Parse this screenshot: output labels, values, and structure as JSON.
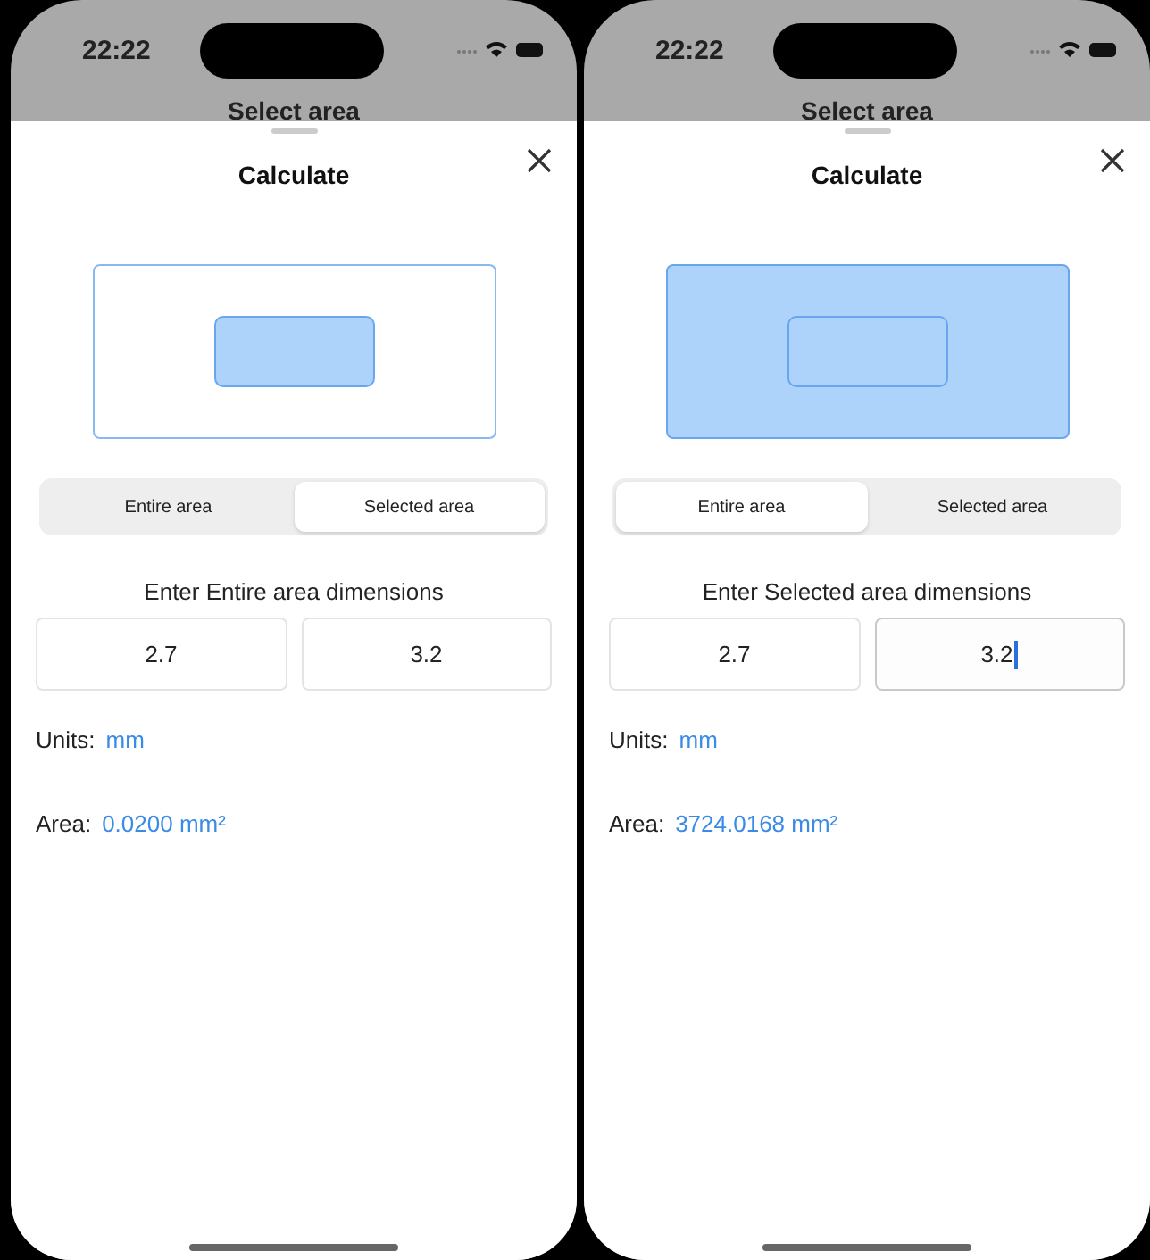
{
  "phones": [
    {
      "status_bar": {
        "time": "22:22"
      },
      "background_title": "Select area",
      "sheet": {
        "title": "Calculate",
        "preview": {
          "outer_filled": false,
          "inner_filled": true
        },
        "segments": [
          {
            "label": "Entire area",
            "selected": false
          },
          {
            "label": "Selected area",
            "selected": true
          }
        ],
        "prompt": "Enter Entire area dimensions",
        "fields": [
          {
            "value": "2.7",
            "focused": false
          },
          {
            "value": "3.2",
            "focused": false
          }
        ],
        "units": {
          "label": "Units:",
          "value": "mm"
        },
        "area": {
          "label": "Area:",
          "value": "0.0200 mm²"
        }
      }
    },
    {
      "status_bar": {
        "time": "22:22"
      },
      "background_title": "Select area",
      "sheet": {
        "title": "Calculate",
        "preview": {
          "outer_filled": true,
          "inner_filled": false
        },
        "segments": [
          {
            "label": "Entire area",
            "selected": true
          },
          {
            "label": "Selected area",
            "selected": false
          }
        ],
        "prompt": "Enter Selected area dimensions",
        "fields": [
          {
            "value": "2.7",
            "focused": false
          },
          {
            "value": "3.2",
            "focused": true
          }
        ],
        "units": {
          "label": "Units:",
          "value": "mm"
        },
        "area": {
          "label": "Area:",
          "value": "3724.0168 mm²"
        }
      }
    }
  ]
}
